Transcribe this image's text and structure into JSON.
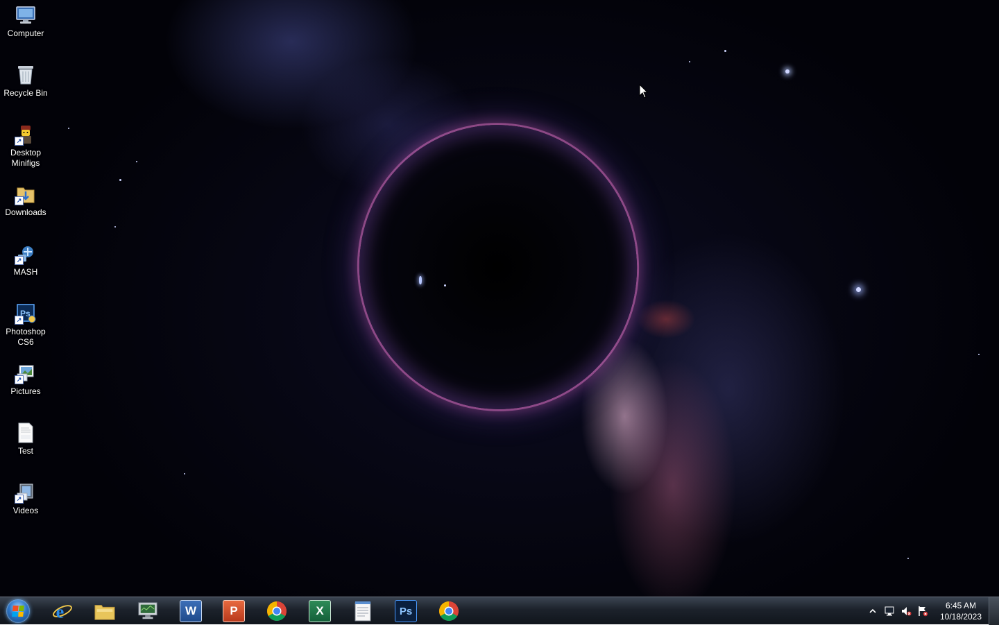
{
  "desktop": {
    "icons": [
      {
        "label": "Computer",
        "icon": "computer-icon"
      },
      {
        "label": "Recycle Bin",
        "icon": "recycle-bin-icon"
      },
      {
        "label": "Desktop\nMinifigs",
        "icon": "minifig-shortcut-icon"
      },
      {
        "label": "Downloads",
        "icon": "downloads-folder-icon"
      },
      {
        "label": "MASH",
        "icon": "mash-shortcut-icon"
      },
      {
        "label": "Photoshop\nCS6",
        "icon": "photoshop-cs6-icon"
      },
      {
        "label": "Pictures",
        "icon": "pictures-folder-icon"
      },
      {
        "label": "Test",
        "icon": "docx-file-icon"
      },
      {
        "label": "Videos",
        "icon": "videos-folder-icon"
      }
    ]
  },
  "taskbar": {
    "pinned": [
      {
        "icon": "internet-explorer-icon",
        "glyph": "e",
        "color": "#2a7fd4"
      },
      {
        "icon": "file-explorer-icon",
        "glyph": "",
        "color": "#e8c55a"
      },
      {
        "icon": "computer-monitor-icon",
        "glyph": "",
        "color": "#6a8f6a"
      },
      {
        "icon": "word-icon",
        "glyph": "W",
        "color": "#2b5797"
      },
      {
        "icon": "powerpoint-icon",
        "glyph": "P",
        "color": "#d24726"
      },
      {
        "icon": "chrome-icon",
        "glyph": "",
        "color": "#4285f4"
      },
      {
        "icon": "excel-icon",
        "glyph": "X",
        "color": "#1e7145"
      },
      {
        "icon": "notepad-icon",
        "glyph": "",
        "color": "#f2f2f2"
      },
      {
        "icon": "photoshop-icon",
        "glyph": "Ps",
        "color": "#001e36"
      },
      {
        "icon": "chrome-icon",
        "glyph": "",
        "color": "#4285f4"
      }
    ],
    "tray": {
      "icons": [
        "show-hidden-icons-chevron",
        "network-icon",
        "volume-muted-icon",
        "action-center-flag-icon"
      ],
      "time": "6:45 AM",
      "date": "10/18/2023"
    }
  },
  "colors": {
    "taskbar": "#1c222b",
    "label_text": "#ffffff",
    "accent_pink": "#e678c8"
  }
}
